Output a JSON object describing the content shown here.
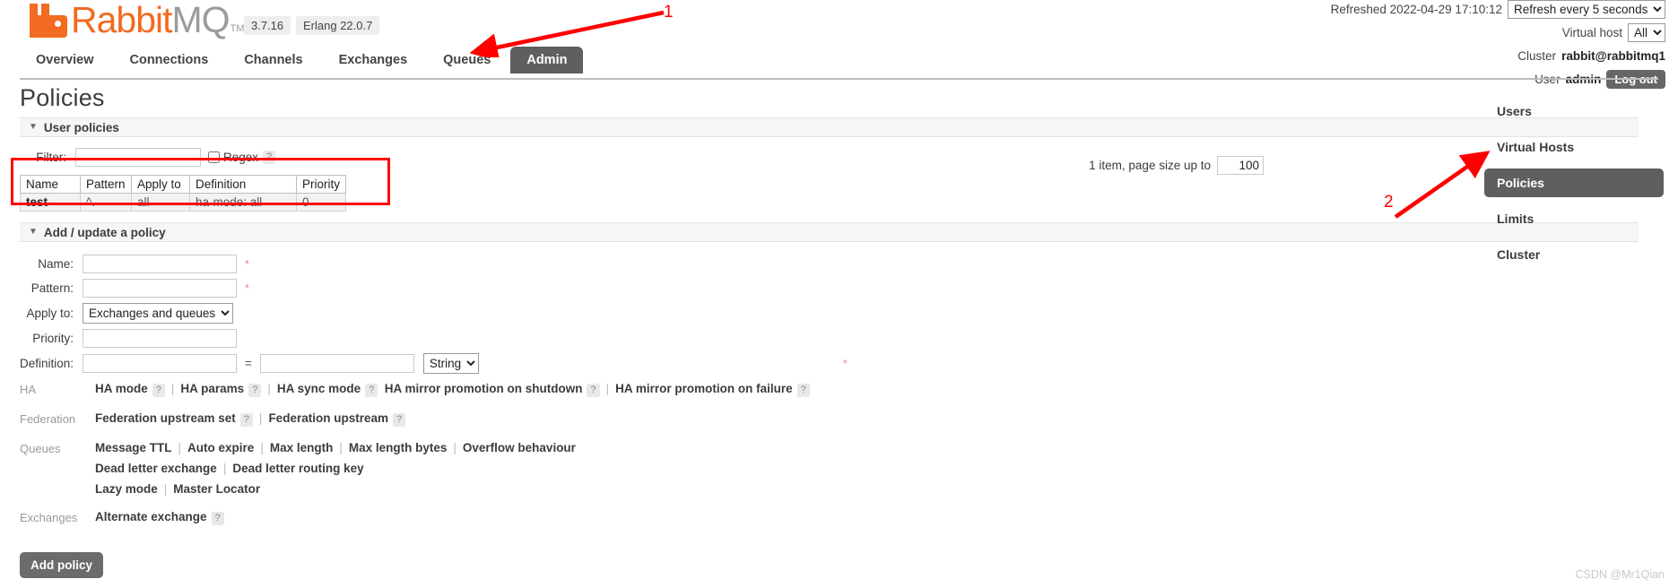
{
  "header": {
    "logo_rabbit": "Rabbit",
    "logo_mq": "MQ",
    "logo_tm": "TM",
    "version": "3.7.16",
    "erlang": "Erlang 22.0.7",
    "refreshed_label": "Refreshed 2022-04-29 17:10:12",
    "refresh_select": "Refresh every 5 seconds",
    "vhost_label": "Virtual host",
    "vhost_select": "All",
    "cluster_label": "Cluster",
    "cluster_name": "rabbit@rabbitmq1",
    "user_label": "User",
    "user_name": "admin",
    "logout_label": "Log out"
  },
  "tabs": [
    {
      "label": "Overview",
      "active": false
    },
    {
      "label": "Connections",
      "active": false
    },
    {
      "label": "Channels",
      "active": false
    },
    {
      "label": "Exchanges",
      "active": false
    },
    {
      "label": "Queues",
      "active": false
    },
    {
      "label": "Admin",
      "active": true
    }
  ],
  "page": {
    "title": "Policies",
    "user_policies_section": "User policies",
    "add_update_section": "Add / update a policy"
  },
  "filter": {
    "label": "Filter:",
    "value": "",
    "regex_label": "Regex",
    "help": "?"
  },
  "paging": {
    "text": "1 item, page size up to",
    "page_size": "100"
  },
  "table": {
    "columns": [
      "Name",
      "Pattern",
      "Apply to",
      "Definition",
      "Priority"
    ],
    "rows": [
      {
        "name": "test",
        "pattern": "^.",
        "apply_to": "all",
        "definition": "ha-mode: all",
        "priority": "0"
      }
    ]
  },
  "form": {
    "name_label": "Name:",
    "name_value": "",
    "pattern_label": "Pattern:",
    "pattern_value": "",
    "apply_to_label": "Apply to:",
    "apply_to_value": "Exchanges and queues",
    "priority_label": "Priority:",
    "priority_value": "",
    "definition_label": "Definition:",
    "definition_key": "",
    "definition_value": "",
    "definition_type": "String",
    "equals": "=",
    "required_mark": "*",
    "submit_label": "Add policy"
  },
  "hints": [
    {
      "category": "HA",
      "lines": [
        [
          {
            "text": "HA mode",
            "help": "?"
          },
          {
            "text": "HA params",
            "help": "?"
          },
          {
            "text": "HA sync mode",
            "help": "?"
          },
          {
            "text": "HA mirror promotion on shutdown",
            "help": "?",
            "nosep": true
          },
          {
            "text": "HA mirror promotion on failure",
            "help": "?"
          }
        ]
      ]
    },
    {
      "category": "Federation",
      "lines": [
        [
          {
            "text": "Federation upstream set",
            "help": "?"
          },
          {
            "text": "Federation upstream",
            "help": "?"
          }
        ]
      ]
    },
    {
      "category": "Queues",
      "lines": [
        [
          {
            "text": "Message TTL"
          },
          {
            "text": "Auto expire"
          },
          {
            "text": "Max length"
          },
          {
            "text": "Max length bytes"
          },
          {
            "text": "Overflow behaviour"
          }
        ],
        [
          {
            "text": "Dead letter exchange"
          },
          {
            "text": "Dead letter routing key"
          }
        ],
        [
          {
            "text": "Lazy mode"
          },
          {
            "text": "Master Locator"
          }
        ]
      ]
    },
    {
      "category": "Exchanges",
      "lines": [
        [
          {
            "text": "Alternate exchange",
            "help": "?"
          }
        ]
      ]
    }
  ],
  "rightnav": [
    {
      "label": "Users",
      "active": false
    },
    {
      "label": "Virtual Hosts",
      "active": false
    },
    {
      "label": "Policies",
      "active": true
    },
    {
      "label": "Limits",
      "active": false
    },
    {
      "label": "Cluster",
      "active": false
    }
  ],
  "annotations": {
    "one": "1",
    "two": "2",
    "accent_color": "#ff0000"
  },
  "watermark": "CSDN @Mr1Qian"
}
